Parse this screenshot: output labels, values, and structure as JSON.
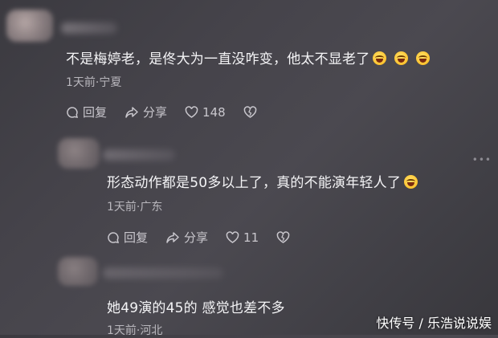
{
  "comments": [
    {
      "text": "不是梅婷老，是佟大为一直没咋变，他太不显老了",
      "emoji_icons": [
        "rofl-emoji-icon",
        "rofl-emoji-icon",
        "rofl-emoji-icon"
      ],
      "meta": "1天前·宁夏",
      "reply_label": "回复",
      "share_label": "分享",
      "like_count": "148"
    },
    {
      "text": "形态动作都是50多以上了，真的不能演年轻人了",
      "emoji_icons": [
        "rofl-emoji-icon"
      ],
      "meta": "1天前·广东",
      "reply_label": "回复",
      "share_label": "分享",
      "like_count": "11"
    },
    {
      "text": "她49演的45的 感觉也差不多",
      "meta": "1天前·河北"
    }
  ],
  "watermark": "快传号 / 乐浩说说娱"
}
